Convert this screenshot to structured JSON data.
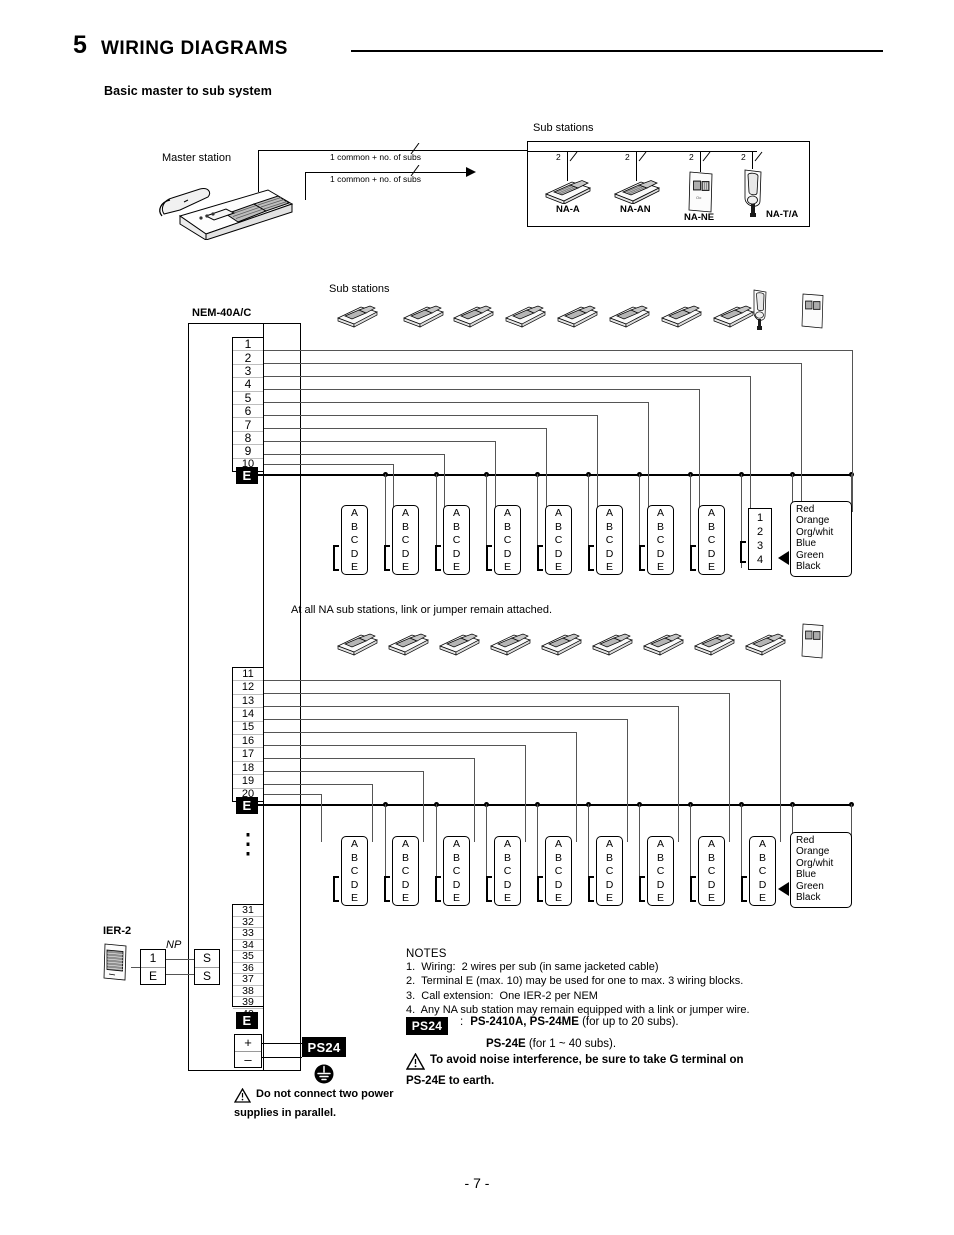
{
  "header": {
    "chapter_number": "5",
    "chapter_title": "WIRING DIAGRAMS",
    "section_title": "Basic master to sub system"
  },
  "top_diagram": {
    "master_label": "Master station",
    "wire_label_1": "1 common + no. of subs",
    "wire_label_2": "1 common + no. of subs",
    "sub_stations_label": "Sub stations",
    "stations": [
      {
        "name": "NA-A",
        "wires": "2",
        "icon": "desk-station-icon"
      },
      {
        "name": "NA-AN",
        "wires": "2",
        "icon": "desk-station-icon"
      },
      {
        "name": "NA-NE",
        "wires": "2",
        "icon": "wall-plate-icon"
      },
      {
        "name": "NA-T/A",
        "wires": "2",
        "icon": "handset-icon"
      }
    ]
  },
  "main_diagram": {
    "nem_label": "NEM-40A/C",
    "sub_stations_label": "Sub stations",
    "mid_note": "At all NA sub stations, link or jumper remain attached.",
    "earth_chip": "E",
    "terminals_block1": [
      "1",
      "2",
      "3",
      "4",
      "5",
      "6",
      "7",
      "8",
      "9",
      "10"
    ],
    "terminals_block2": [
      "11",
      "12",
      "13",
      "14",
      "15",
      "16",
      "17",
      "18",
      "19",
      "20"
    ],
    "terminals_block3": [
      "31",
      "32",
      "33",
      "34",
      "35",
      "36",
      "37",
      "38",
      "39",
      "40"
    ],
    "ellipsis": "⋮",
    "connector_labels": [
      "A",
      "B",
      "C",
      "D",
      "E"
    ],
    "numeric_connector_labels": [
      "1",
      "2",
      "3",
      "4"
    ],
    "color_legend": [
      "Red",
      "Orange",
      "Org/whit",
      "Blue",
      "Green",
      "Black"
    ],
    "row1_station_count": 8,
    "row2_station_count": 9,
    "row1_connector_count": 8,
    "row2_connector_count": 9,
    "row1_extra_icons": [
      "handset-icon",
      "wall-plate-icon"
    ],
    "row2_extra_icons": [
      "wall-plate-icon"
    ]
  },
  "ier": {
    "label": "IER-2",
    "np_label": "NP",
    "terminal_top": "1",
    "terminal_bottom": "E",
    "remote_top": "S",
    "remote_bottom": "S"
  },
  "power": {
    "plus": "+",
    "minus": "–",
    "ps24_chip": "PS24",
    "earth_chip": "E",
    "ground_icon": "earth-ground-icon"
  },
  "notes": {
    "heading": "NOTES",
    "items": [
      "1.  Wiring:  2 wires per sub (in same jacketed cable)",
      "2.  Terminal E (max. 10) may be used for one to max. 3 wiring blocks.",
      "3.  Call extension:  One IER-2 per NEM",
      "4.  Any NA sub station may remain equipped with a link or jumper wire."
    ],
    "ps24_chip": "PS24",
    "ps24_colon": ":",
    "ps24_line1_bold": "PS-2410A, PS-24ME",
    "ps24_line1_rest": " (for up to 20 subs).",
    "ps24_line2_bold": "PS-24E",
    "ps24_line2_rest": " (for 1 ~ 40 subs).",
    "warning_noise": "To avoid noise interference, be sure to take G terminal on\nPS-24E to earth.",
    "warning_power": "Do not connect two power\nsupplies in parallel."
  },
  "footer": {
    "page_number": "- 7 -"
  }
}
